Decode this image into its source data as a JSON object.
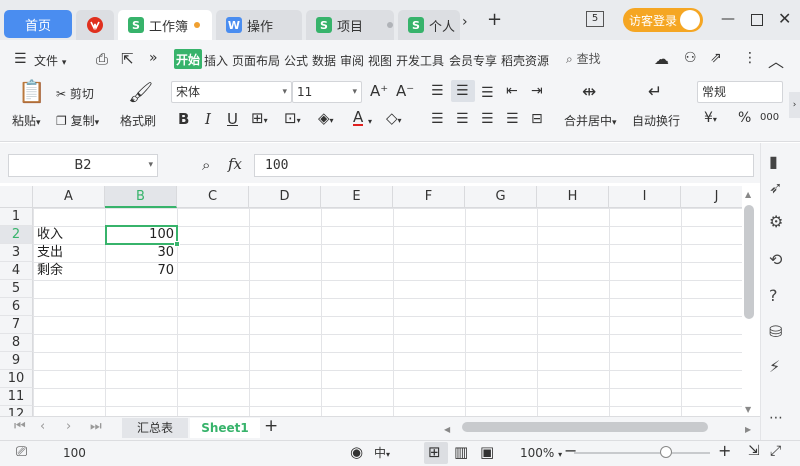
{
  "titlebar": {
    "home_tab": "首页",
    "tabs": [
      {
        "label": "工作簿",
        "icon": "S"
      },
      {
        "label": "操作",
        "icon": "W"
      },
      {
        "label": "项目",
        "icon": "S"
      },
      {
        "label": "个人",
        "icon": "S"
      }
    ],
    "page_badge": "5",
    "login_label": "访客登录"
  },
  "menu": {
    "file_label": "文件",
    "items": [
      "开始",
      "插入",
      "页面布局",
      "公式",
      "数据",
      "审阅",
      "视图",
      "开发工具",
      "会员专享",
      "稻壳资源"
    ],
    "search_label": "查找"
  },
  "ribbon": {
    "paste_label": "粘贴",
    "cut_label": "剪切",
    "copy_label": "复制",
    "format_painter_label": "格式刷",
    "font_name": "宋体",
    "font_size": "11",
    "merge_label": "合并居中",
    "wrap_label": "自动换行",
    "number_format": "常规"
  },
  "formula_bar": {
    "cell_ref": "B2",
    "fx_label": "fx",
    "value": "100"
  },
  "grid": {
    "columns": [
      "A",
      "B",
      "C",
      "D",
      "E",
      "F",
      "G",
      "H",
      "I",
      "J"
    ],
    "rows": [
      "1",
      "2",
      "3",
      "4",
      "5",
      "6",
      "7",
      "8",
      "9",
      "10",
      "11",
      "12"
    ],
    "cells": {
      "A2": "收入",
      "B2": "100",
      "A3": "支出",
      "B3": "30",
      "A4": "剩余",
      "B4": "70"
    }
  },
  "sheets": {
    "tabs": [
      "汇总表",
      "Sheet1"
    ],
    "active": "Sheet1"
  },
  "status": {
    "value": "100",
    "zoom": "100%"
  },
  "colors": {
    "accent": "#37b36b",
    "home_tab": "#4a8df0",
    "login": "#f5a623"
  }
}
